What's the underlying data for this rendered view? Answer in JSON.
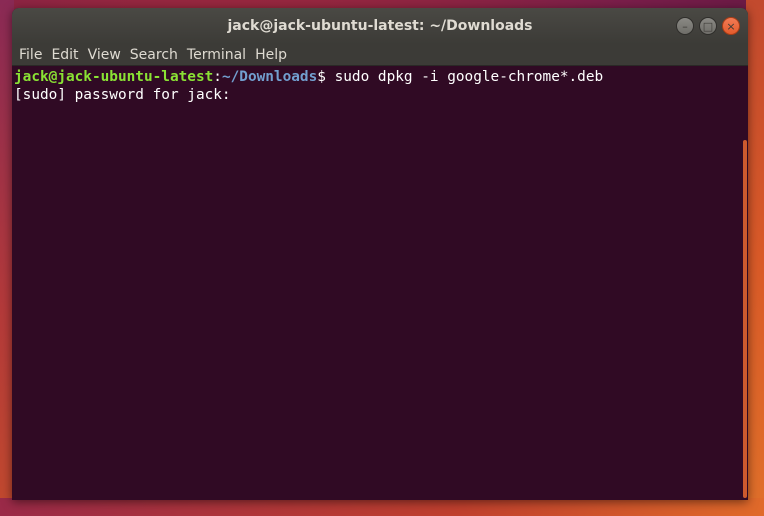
{
  "window": {
    "title": "jack@jack-ubuntu-latest: ~/Downloads",
    "controls": {
      "minimize": "–",
      "maximize": "□",
      "close": "×"
    }
  },
  "menubar": {
    "items": [
      "File",
      "Edit",
      "View",
      "Search",
      "Terminal",
      "Help"
    ]
  },
  "terminal": {
    "lines": [
      {
        "user_host": "jack@jack-ubuntu-latest",
        "colon": ":",
        "path": "~/Downloads",
        "dollar": "$ ",
        "command": "sudo dpkg -i google-chrome*.deb"
      },
      {
        "output": "[sudo] password for jack: "
      }
    ]
  },
  "colors": {
    "terminal_bg": "#300a24",
    "prompt_user": "#8ae234",
    "prompt_path": "#729fcf",
    "titlebar_bg": "#3c3b37",
    "close_button": "#e35b2c"
  }
}
